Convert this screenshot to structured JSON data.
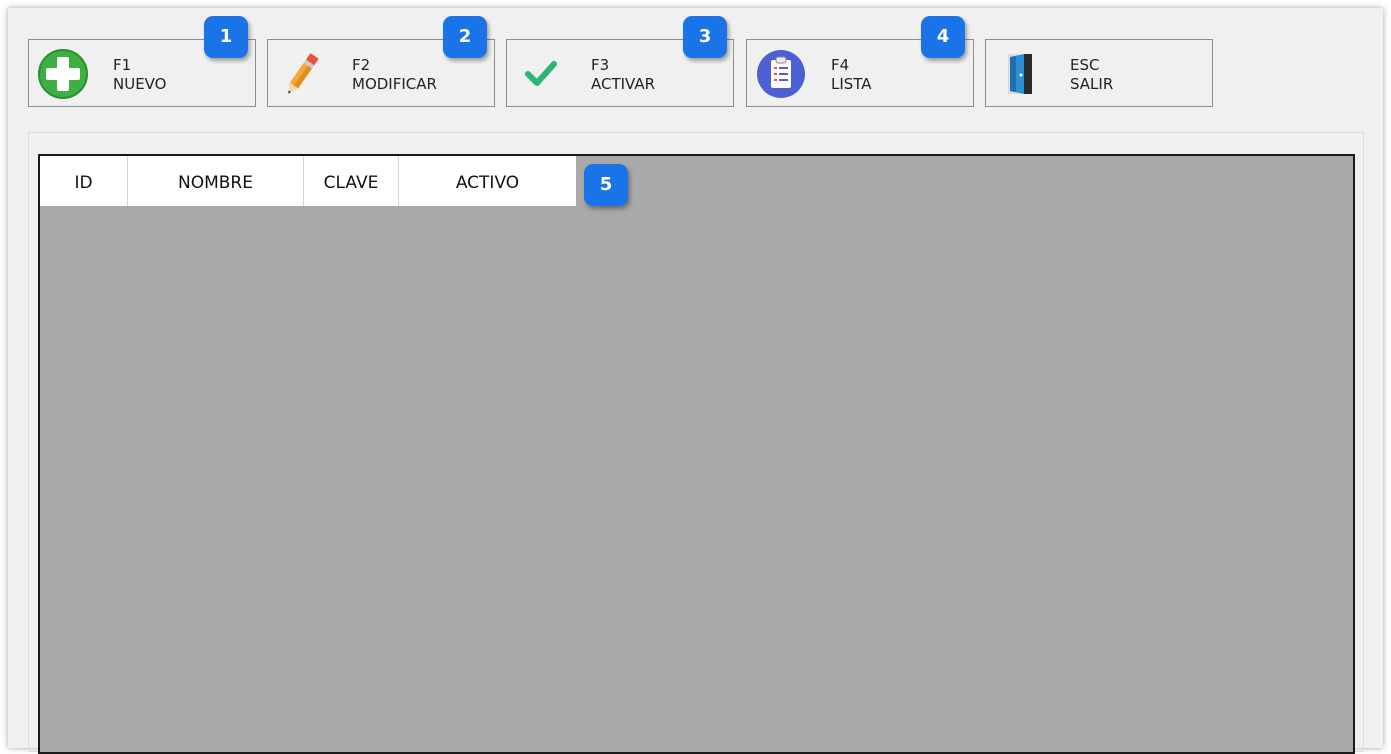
{
  "toolbar": {
    "buttons": [
      {
        "key": "F1",
        "label": "NUEVO",
        "icon": "plus-circle-icon",
        "badge": "1"
      },
      {
        "key": "F2",
        "label": "MODIFICAR",
        "icon": "pencil-icon",
        "badge": "2"
      },
      {
        "key": "F3",
        "label": "ACTIVAR",
        "icon": "checkmark-icon",
        "badge": "3"
      },
      {
        "key": "F4",
        "label": "LISTA",
        "icon": "clipboard-list-icon",
        "badge": "4"
      },
      {
        "key": "ESC",
        "label": "SALIR",
        "icon": "exit-door-icon",
        "badge": ""
      }
    ]
  },
  "grid": {
    "columns": [
      "ID",
      "NOMBRE",
      "CLAVE",
      "ACTIVO"
    ],
    "badge": "5",
    "rows": []
  },
  "colors": {
    "badge": "#1b73e8",
    "grid_background": "#a9a9a9",
    "window_background": "#f0f0f0"
  }
}
